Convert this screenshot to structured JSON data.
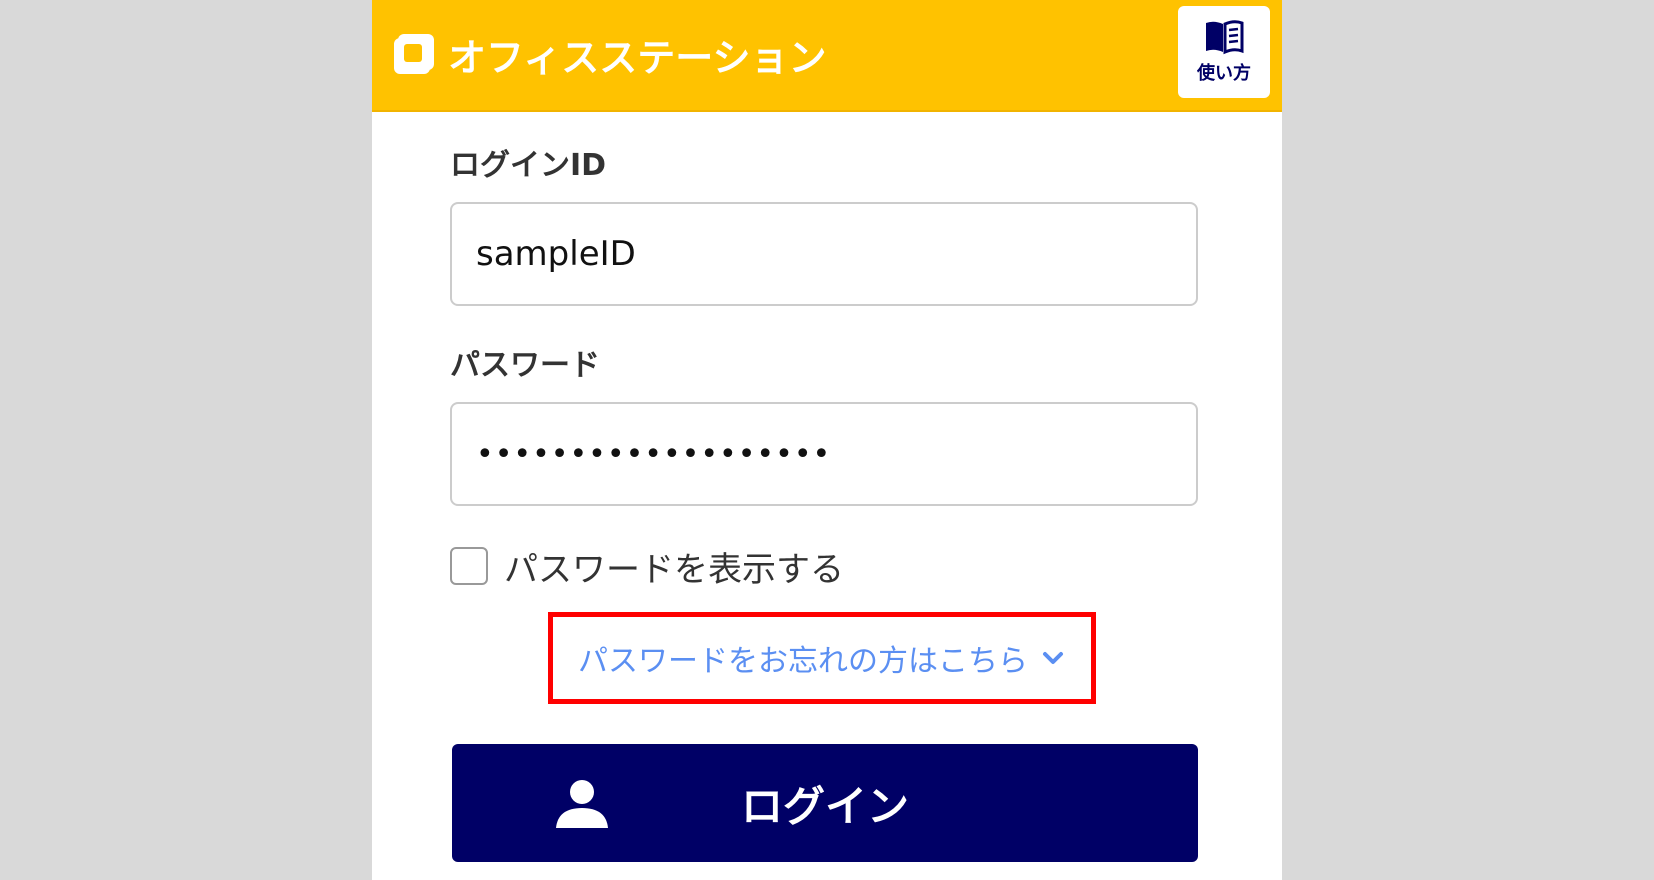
{
  "header": {
    "app_name": "オフィスステーション",
    "howto_label": "使い方",
    "background_color": "#ffc200",
    "logo_icon": "office-station-logo",
    "howto_icon": "book-icon"
  },
  "form": {
    "login_id_label": "ログインID",
    "login_id_value": "sampleID",
    "password_label": "パスワード",
    "password_value": "•••••••••••••••••••",
    "show_password_label": "パスワードを表示する",
    "show_password_checked": false,
    "forgot_password_link": "パスワードをお忘れの方はこちら",
    "forgot_icon": "chevron-down-icon",
    "link_color": "#5b8ff2",
    "highlight_color": "#ff0000"
  },
  "login_button": {
    "label": "ログイン",
    "icon": "user-icon",
    "color": "#000066"
  }
}
